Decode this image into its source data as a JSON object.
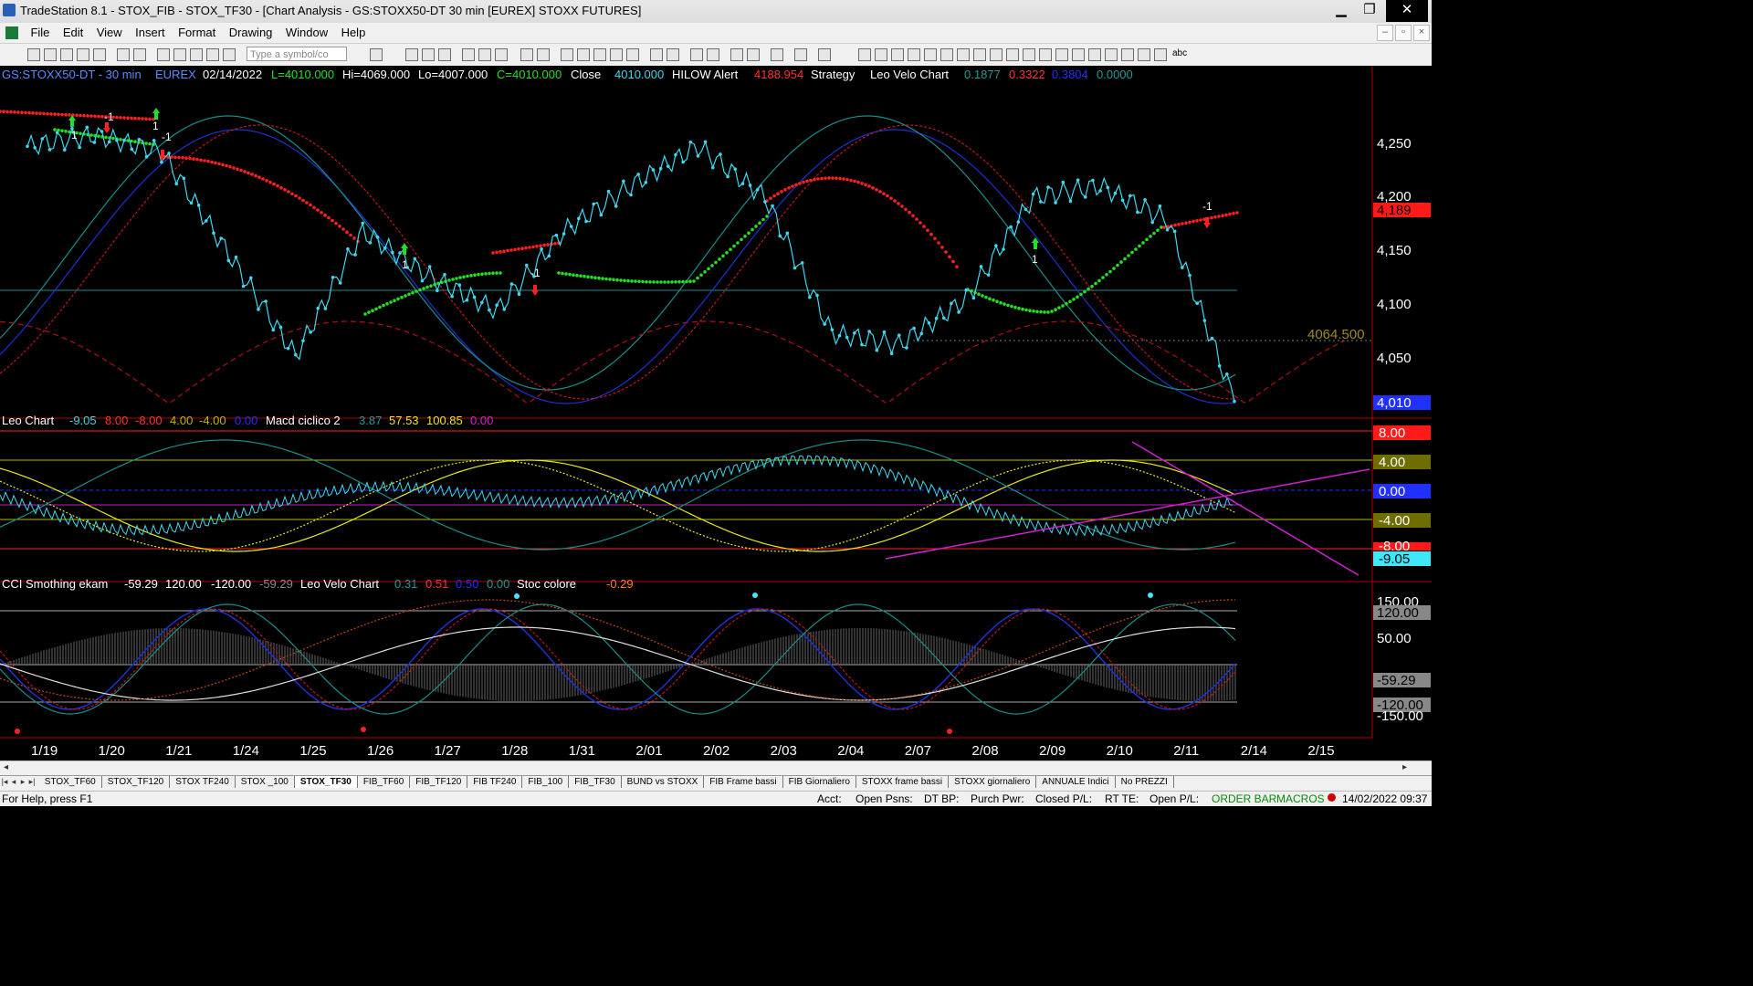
{
  "window": {
    "title": "TradeStation 8.1 - STOX_FIB - STOX_TF30 - [Chart Analysis - GS:STOXX50-DT  30 min  [EUREX] STOXX FUTURES]",
    "minimize": "▁",
    "restore": "❐",
    "close": "✕"
  },
  "menu": [
    "File",
    "Edit",
    "View",
    "Insert",
    "Format",
    "Drawing",
    "Window",
    "Help"
  ],
  "toolbar": {
    "symbol_placeholder": "Type a symbol/co",
    "end_label": "abc"
  },
  "header": {
    "symbol": "GS:STOXX50-DT - 30 min",
    "exchange": "EUREX",
    "date": "02/14/2022",
    "last": "L=4010.000",
    "high": "Hi=4069.000",
    "low": "Lo=4007.000",
    "close": "C=4010.000",
    "close_label": "Close",
    "close_value": "4010.000",
    "hilow_label": "HILOW Alert",
    "hilow_value": "4188.954",
    "strategy_label": "Strategy",
    "leovelo_label": "Leo Velo Chart",
    "leovelo_v1": "0.1877",
    "leovelo_v2": "0.3322",
    "leovelo_v3": "0.3804",
    "leovelo_v4": "0.0000"
  },
  "price_axis": {
    "ticks": [
      "4,250",
      "4,200",
      "4,150",
      "4,100",
      "4,050"
    ],
    "hilow_badge": "4,189",
    "last_badge": "4,010",
    "level_label": "4064.500"
  },
  "panel2": {
    "leo_label": "Leo Chart",
    "leo_vals": [
      "-9.05",
      "8.00",
      "-8.00",
      "4.00",
      "-4.00",
      "0.00"
    ],
    "macd_label": "Macd ciclico 2",
    "macd_vals": [
      "3.87",
      "57.53",
      "100.85",
      "0.00"
    ],
    "axis_badges": [
      "8.00",
      "4.00",
      "0.00",
      "-4.00",
      "-8.00",
      "-9.05"
    ]
  },
  "panel3": {
    "cci_label": "CCI Smothing ekam",
    "cci_vals": [
      "-59.29",
      "120.00",
      "-120.00",
      "-59.29"
    ],
    "leovelo_label": "Leo Velo Chart",
    "leovelo_vals": [
      "0.31",
      "0.51",
      "0.50",
      "0.00"
    ],
    "stoc_label": "Stoc colore",
    "stoc_val": "-0.29",
    "axis_labels": [
      "150.00",
      "120.00",
      "50.00",
      "-59.29",
      "-120.00",
      "-150.00"
    ]
  },
  "date_axis": [
    "1/19",
    "1/20",
    "1/21",
    "1/24",
    "1/25",
    "1/26",
    "1/27",
    "1/28",
    "1/31",
    "2/01",
    "2/02",
    "2/03",
    "2/04",
    "2/07",
    "2/08",
    "2/09",
    "2/10",
    "2/11",
    "2/14",
    "2/15"
  ],
  "annotations": [
    "-1",
    "1",
    "1",
    "-1",
    "1",
    "-1",
    "1",
    "-1"
  ],
  "tabs": [
    "STOX_TF60",
    "STOX_TF120",
    "STOX TF240",
    "STOX _100",
    "STOX_TF30",
    "FIB_TF60",
    "FIB_TF120",
    "FIB TF240",
    "FIB_100",
    "FIB_TF30",
    "BUND vs STOXX",
    "FIB Frame bassi",
    "FIB Giornaliero",
    "STOXX frame bassi",
    "STOXX giornaliero",
    "ANNUALE Indici",
    "No PREZZI"
  ],
  "active_tab": "STOX_TF30",
  "status": {
    "help": "For Help, press F1",
    "acct": "Acct:",
    "open_psns": "Open Psns:",
    "dt_bp": "DT BP:",
    "purch_pwr": "Purch Pwr:",
    "closed_pl": "Closed P/L:",
    "rt_te": "RT TE:",
    "open_pl": "Open P/L:",
    "order_bar": "ORDER BAR",
    "macros": "MACROS",
    "datetime": "14/02/2022 09:37"
  },
  "chart_data": {
    "type": "line",
    "title": "GS:STOXX50-DT - 30 min",
    "x": [
      "1/19",
      "1/20",
      "1/21",
      "1/24",
      "1/25",
      "1/26",
      "1/27",
      "1/28",
      "1/31",
      "2/01",
      "2/02",
      "2/03",
      "2/04",
      "2/07",
      "2/08",
      "2/09",
      "2/10",
      "2/11",
      "2/14"
    ],
    "series": [
      {
        "name": "Close",
        "values": [
          4235,
          4245,
          4230,
          4140,
          4050,
          4160,
          4120,
          4090,
          4160,
          4200,
          4235,
          4190,
          4070,
          4060,
          4100,
          4190,
          4200,
          4170,
          4010
        ]
      }
    ],
    "ylim": [
      4000,
      4290
    ],
    "grid": false
  },
  "colors": {
    "price": "#3fd7ee",
    "bull_dots": "#22e022",
    "bear_dots": "#ff2020",
    "blue_wave": "#1f2fd0",
    "teal_wave": "#178f8a",
    "red_wave": "#c01818",
    "yellow": "#e8e820",
    "magenta": "#d020d0"
  }
}
